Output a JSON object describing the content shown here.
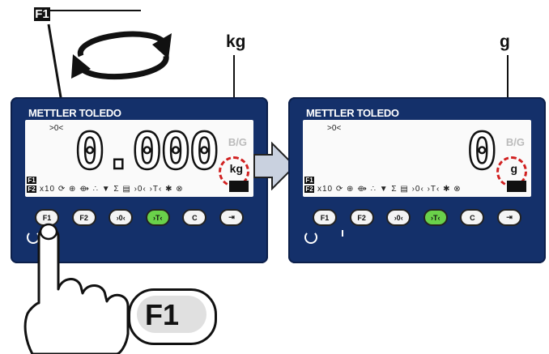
{
  "top_indicator": {
    "key_label": "F1"
  },
  "units": {
    "left": "kg",
    "right": "g"
  },
  "terminals": [
    {
      "brand": "METTLER TOLEDO",
      "zero_indicator": ">0<",
      "readout": "0.000",
      "bg_indicator": "B/G",
      "unit": "kg",
      "f1": "F1",
      "f2": "F2",
      "status_icons": "x10 ⟳ ⊕ ⟴ ∴ ▼ Σ ▤ ›0‹ ›T‹ ✱ ⊗",
      "keys": [
        "F1",
        "F2",
        "›0‹",
        "›T‹",
        "C",
        "⇥"
      ]
    },
    {
      "brand": "METTLER TOLEDO",
      "zero_indicator": ">0<",
      "readout": "0",
      "bg_indicator": "B/G",
      "unit": "g",
      "f1": "F1",
      "f2": "F2",
      "status_icons": "x10 ⟳ ⊕ ⟴ ∴ ▼ Σ ▤ ›0‹ ›T‹ ✱ ⊗",
      "keys": [
        "F1",
        "F2",
        "›0‹",
        "›T‹",
        "C",
        "⇥"
      ]
    }
  ],
  "badge": {
    "label": "F1"
  },
  "colors": {
    "panel": "#14306a",
    "circle": "#d12020",
    "tare_key": "#6ad14a"
  }
}
